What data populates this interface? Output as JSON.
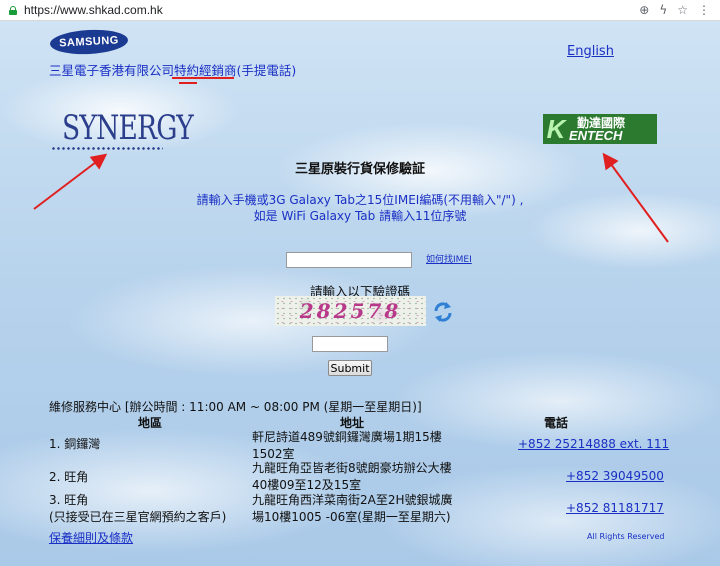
{
  "browser": {
    "url": "https://www.shkad.com.hk",
    "icons": [
      "zoom-icon",
      "lightning-icon",
      "star-icon",
      "menu-icon"
    ]
  },
  "header": {
    "samsung_logo_text": "SAMSUNG",
    "company_prefix": "三星電子香港有限公司",
    "company_highlight": "特約經銷商",
    "company_suffix": "(手提電話)",
    "english_link": "English"
  },
  "logos": {
    "synergy": "SYNERGY",
    "kentech_cn": "勤達國際",
    "kentech_en": "ENTECH",
    "kentech_k": "K"
  },
  "form": {
    "heading": "三星原裝行貨保修驗証",
    "instruction_line1": "請輸入手機或3G Galaxy Tab之15位IMEI編碼(不用輸入\"/\") ,",
    "instruction_line2": "如是 WiFi Galaxy Tab 請輸入11位序號",
    "imei_value": "",
    "how_to_find_link": "如何找IMEI",
    "captcha_label": "請輸入以下驗證碼",
    "captcha_code": "282578",
    "code_value": "",
    "submit_label": "Submit"
  },
  "service": {
    "title": "維修服務中心 [辦公時間 : 11:00 AM ~ 08:00 PM (星期一至星期日)]",
    "headers": {
      "district": "地區",
      "address": "地址",
      "phone": "電話"
    },
    "rows": [
      {
        "district": "1. 銅鑼灣",
        "note": "",
        "address_line1": "軒尼詩道489號銅鑼灣廣場1期15樓",
        "address_line2": "1502室",
        "phone": "+852 25214888 ext. 111"
      },
      {
        "district": "2. 旺角",
        "note": "",
        "address_line1": "九龍旺角亞皆老街8號朗豪坊辦公大樓",
        "address_line2": "40樓09至12及15室",
        "phone": "+852 39049500"
      },
      {
        "district": "3. 旺角",
        "note": "(只接受已在三星官網預約之客戶)",
        "address_line1": "九龍旺角西洋菜南街2A至2H號銀城廣",
        "address_line2": "場10樓1005 -06室(星期一至星期六)",
        "phone": "+852 81181717"
      }
    ]
  },
  "footer": {
    "terms_link": "保養細則及條款",
    "rights": "All Rights Reserved"
  },
  "colors": {
    "link_blue": "#1a2fc4",
    "annotation_red": "#e02020",
    "samsung_blue": "#1b3a92",
    "kentech_green": "#2b7a2f"
  }
}
